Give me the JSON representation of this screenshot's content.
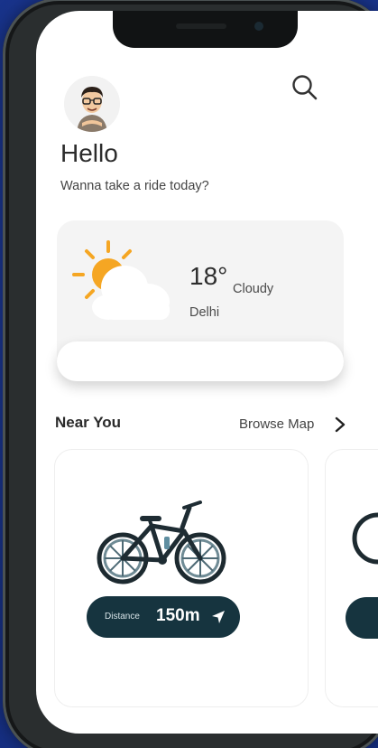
{
  "header": {
    "greeting": "Hello",
    "subtitle": "Wanna take a ride today?"
  },
  "weather": {
    "temperature": "18°",
    "condition": "Cloudy",
    "city": "Delhi",
    "icon": "partly-cloudy-icon"
  },
  "near_you": {
    "title": "Near You",
    "browse_label": "Browse Map",
    "bikes": [
      {
        "distance_label": "Distance",
        "distance_value": "150m"
      }
    ]
  },
  "colors": {
    "background": "#1d3c9c",
    "dark_accent": "#16343f",
    "sun": "#f5a623"
  }
}
